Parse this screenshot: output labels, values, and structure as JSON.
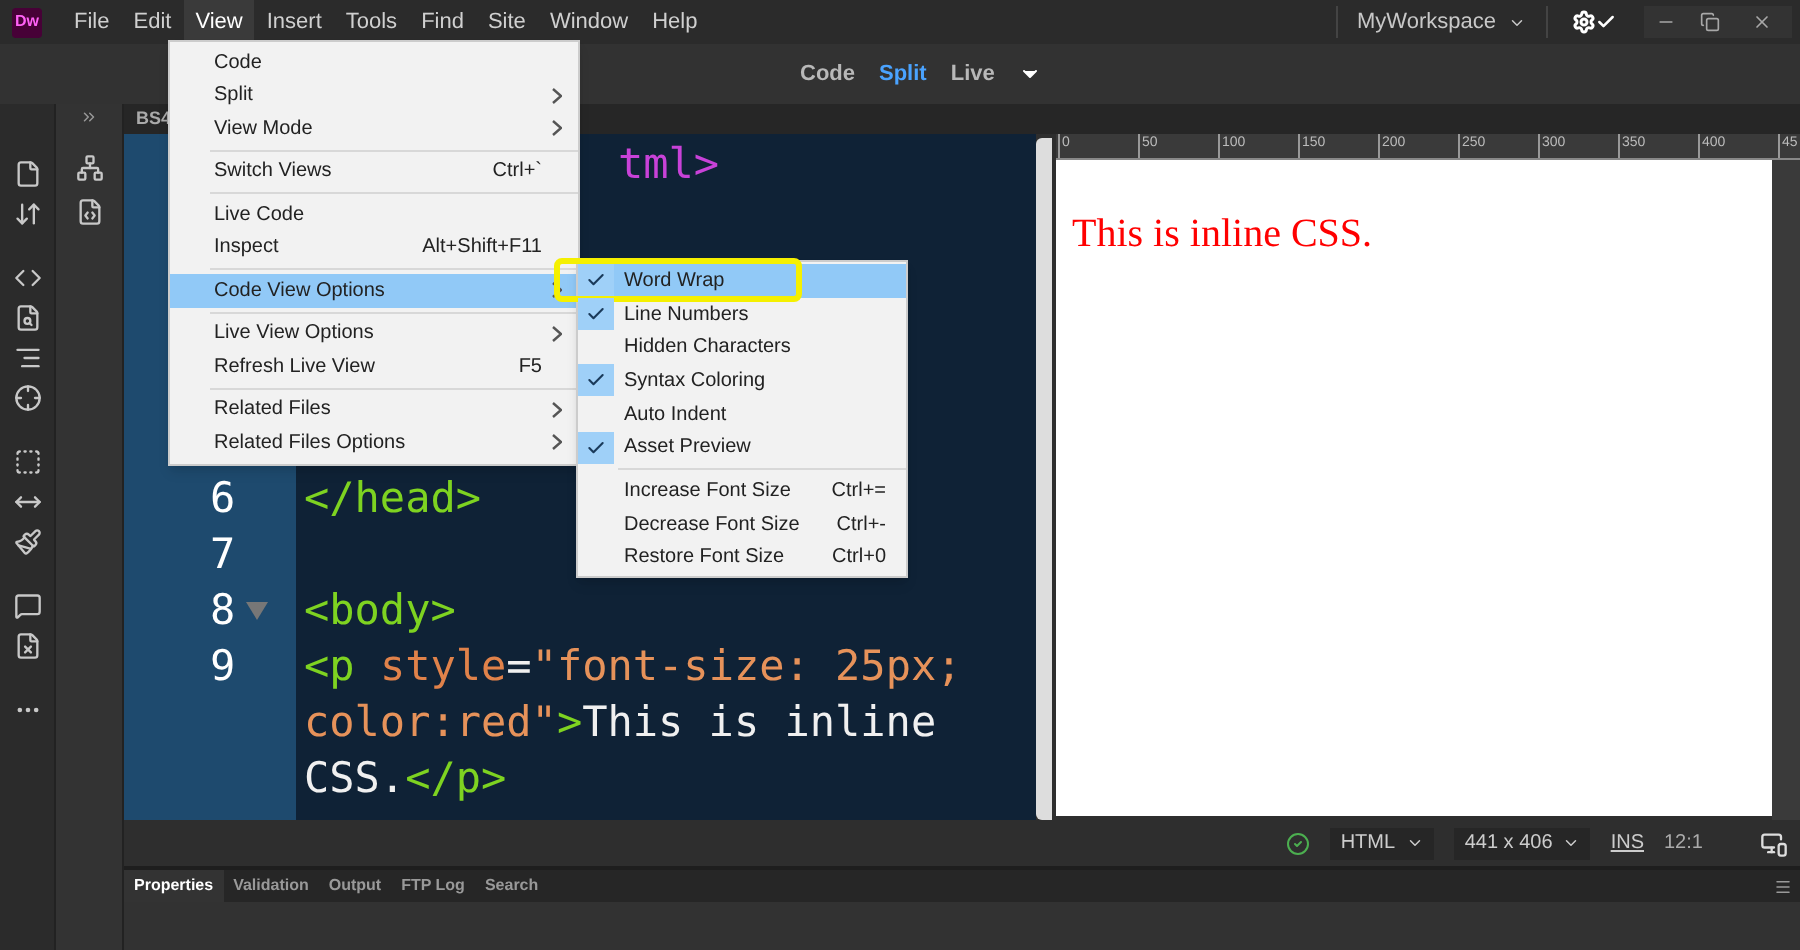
{
  "app_logo": "Dw",
  "menu_bar": [
    {
      "label": "File",
      "selected": false
    },
    {
      "label": "Edit",
      "selected": false
    },
    {
      "label": "View",
      "selected": true
    },
    {
      "label": "Insert",
      "selected": false
    },
    {
      "label": "Tools",
      "selected": false
    },
    {
      "label": "Find",
      "selected": false
    },
    {
      "label": "Site",
      "selected": false
    },
    {
      "label": "Window",
      "selected": false
    },
    {
      "label": "Help",
      "selected": false
    }
  ],
  "workspace": "MyWorkspace",
  "view_switcher": [
    {
      "label": "Code",
      "selected": false
    },
    {
      "label": "Split",
      "selected": true
    },
    {
      "label": "Live",
      "selected": false
    }
  ],
  "document_tab": "BS4",
  "code_lines": [
    {
      "segments": [
        {
          "text": "tml>",
          "kind": "tag"
        }
      ]
    },
    {
      "number": "6",
      "foldable": false,
      "rows": [
        {
          "segments": [
            {
              "text": "</head>",
              "kind": "bracket"
            }
          ]
        }
      ]
    },
    {
      "number": "7",
      "foldable": false
    },
    {
      "number": "8",
      "foldable": true,
      "rows": [
        {
          "segments": [
            {
              "text": "<body>",
              "kind": "bracket"
            }
          ]
        }
      ]
    },
    {
      "number": "9",
      "foldable": false,
      "rows": [
        {
          "segments": [
            {
              "text": "<p ",
              "kind": "bracket"
            },
            {
              "text": "style",
              "kind": "attr"
            },
            {
              "text": "=",
              "kind": "plain"
            },
            {
              "text": "\"font-size: 25px;",
              "kind": "string"
            }
          ]
        },
        {
          "segments": [
            {
              "text": "color:red\"",
              "kind": "string"
            },
            {
              "text": ">",
              "kind": "bracket"
            },
            {
              "text": "This is inline",
              "kind": "plain"
            }
          ]
        },
        {
          "segments": [
            {
              "text": "CSS.",
              "kind": "plain"
            },
            {
              "text": "</p>",
              "kind": "bracket"
            }
          ]
        }
      ]
    }
  ],
  "view_menu": [
    {
      "kind": "item",
      "label": "Code",
      "submenu": false,
      "selected": false
    },
    {
      "kind": "item",
      "label": "Split",
      "submenu": true,
      "selected": false
    },
    {
      "kind": "item",
      "label": "View Mode",
      "submenu": true,
      "selected": false
    },
    {
      "kind": "separator"
    },
    {
      "kind": "item",
      "label": "Switch Views",
      "shortcut": "Ctrl+`",
      "submenu": false,
      "selected": false
    },
    {
      "kind": "separator"
    },
    {
      "kind": "item",
      "label": "Live Code",
      "submenu": false,
      "selected": false
    },
    {
      "kind": "item",
      "label": "Inspect",
      "shortcut": "Alt+Shift+F11",
      "submenu": false,
      "selected": false
    },
    {
      "kind": "separator"
    },
    {
      "kind": "item",
      "label": "Code View Options",
      "submenu": true,
      "selected": true
    },
    {
      "kind": "separator"
    },
    {
      "kind": "item",
      "label": "Live View Options",
      "submenu": true,
      "selected": false
    },
    {
      "kind": "item",
      "label": "Refresh Live View",
      "shortcut": "F5",
      "submenu": false,
      "selected": false
    },
    {
      "kind": "separator"
    },
    {
      "kind": "item",
      "label": "Related Files",
      "submenu": true,
      "selected": false
    },
    {
      "kind": "item",
      "label": "Related Files Options",
      "submenu": true,
      "selected": false
    }
  ],
  "code_view_submenu": [
    {
      "kind": "item",
      "label": "Word Wrap",
      "checked": true,
      "selected": true,
      "callout": true
    },
    {
      "kind": "item",
      "label": "Line Numbers",
      "checked": true,
      "selected": false,
      "callout": false
    },
    {
      "kind": "item",
      "label": "Hidden Characters",
      "checked": false,
      "selected": false,
      "callout": false
    },
    {
      "kind": "item",
      "label": "Syntax Coloring",
      "checked": true,
      "selected": false,
      "callout": false
    },
    {
      "kind": "item",
      "label": "Auto Indent",
      "checked": false,
      "selected": false,
      "callout": false
    },
    {
      "kind": "item",
      "label": "Asset Preview",
      "checked": true,
      "selected": false,
      "callout": false
    },
    {
      "kind": "separator"
    },
    {
      "kind": "item",
      "label": "Increase Font Size",
      "shortcut": "Ctrl+=",
      "checked": false,
      "selected": false,
      "callout": false
    },
    {
      "kind": "item",
      "label": "Decrease Font Size",
      "shortcut": "Ctrl+-",
      "checked": false,
      "selected": false,
      "callout": false
    },
    {
      "kind": "item",
      "label": "Restore Font Size",
      "shortcut": "Ctrl+0",
      "checked": false,
      "selected": false,
      "callout": false
    }
  ],
  "ruler_labels": [
    "0",
    "50",
    "100",
    "150",
    "200",
    "250",
    "300",
    "350",
    "400",
    "45"
  ],
  "preview_text": "This is inline CSS.",
  "status_bar": {
    "document_type": "HTML",
    "window_size": "441 x 406",
    "insert_mode": "INS",
    "cursor_position": "12:1"
  },
  "panel_tabs": [
    {
      "label": "Properties",
      "selected": true
    },
    {
      "label": "Validation",
      "selected": false
    },
    {
      "label": "Output",
      "selected": false
    },
    {
      "label": "FTP Log",
      "selected": false
    },
    {
      "label": "Search",
      "selected": false
    }
  ]
}
